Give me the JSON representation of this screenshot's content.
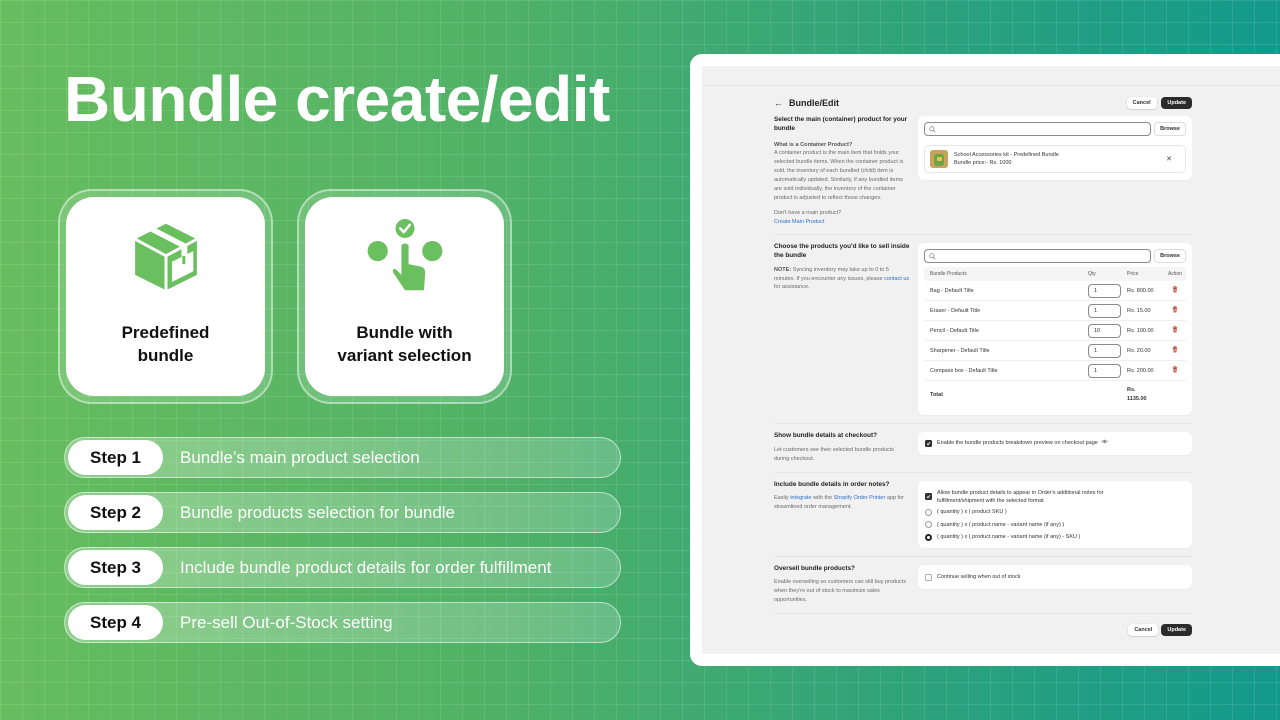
{
  "hero": {
    "title": "Bundle create/edit"
  },
  "feature_cards": [
    {
      "icon": "package-box-icon",
      "label_line1": "Predefined",
      "label_line2": "bundle"
    },
    {
      "icon": "variant-selection-hand-icon",
      "label_line1": "Bundle with",
      "label_line2": "variant selection"
    }
  ],
  "steps": [
    {
      "badge": "Step 1",
      "text": "Bundle’s main product selection"
    },
    {
      "badge": "Step 2",
      "text": "Bundle products selection for bundle"
    },
    {
      "badge": "Step 3",
      "text": "Include bundle product details for order fulfillment"
    },
    {
      "badge": "Step 4",
      "text": "Pre-sell Out-of-Stock setting"
    }
  ],
  "app": {
    "page_title": "Bundle/Edit",
    "cancel_label": "Cancel",
    "update_label": "Update",
    "browse_label": "Browse",
    "search_placeholder": "",
    "section_main": {
      "title": "Select the main (container) product for your bundle",
      "subtitle": "What is a Container Product?",
      "body": "A container product is the main item that holds your selected bundle items. When the container product is sold, the inventory of each bundled (child) item is automatically updated. Similarly, if any bundled items are sold individually, the inventory of the container product is adjusted to reflect those changes.",
      "no_product_text": "Don't have a main product?",
      "create_link": "Create Main Product",
      "selected_product": {
        "name": "School Accessories kit - Predefined Bundle",
        "price": "Bundle price:- Rs. 1000"
      }
    },
    "section_products": {
      "title": "Choose the products you'd like to sell inside the bundle",
      "note_label": "NOTE:",
      "note_body": " Syncing inventory may take up to 0 to 5 minutes. If you encounter any issues, please ",
      "contact_link": "contact us",
      "note_tail": " for assistance.",
      "columns": {
        "name": "Bundle Products",
        "qty": "Qty",
        "price": "Price",
        "action": "Action"
      },
      "rows": [
        {
          "name": "Bag - Default Title",
          "qty": "1",
          "price": "Rs. 800.00"
        },
        {
          "name": "Eraser - Default Title",
          "qty": "1",
          "price": "Rs. 15.00"
        },
        {
          "name": "Pencil - Default Title",
          "qty": "10",
          "price": "Rs. 100.00"
        },
        {
          "name": "Sharpener - Default Title",
          "qty": "1",
          "price": "Rs. 20.00"
        },
        {
          "name": "Compass box - Default Title",
          "qty": "1",
          "price": "Rs. 200.00"
        }
      ],
      "total_label": "Total",
      "total_currency": "Rs.",
      "total_value": "1135.00"
    },
    "section_checkout": {
      "title": "Show bundle details at checkout?",
      "body": "Let customers see their selected bundle products during checkout.",
      "checkbox_label": "Enable the bundle products breakdown preview on checkout page",
      "checked": true
    },
    "section_order_notes": {
      "title": "Include bundle details in order notes?",
      "body_pre": "Easily ",
      "integrate_link": "integrate",
      "body_mid": " with the ",
      "printer_link": "Shopify Order Printer",
      "body_post": " app for streamlined order management.",
      "checkbox_label": "Allow bundle product details to appear in Order's additional notes for fulfillment/shipment with the selected format",
      "checked": true,
      "formats": [
        {
          "label": "( quantity ) x ( product SKU )",
          "selected": false
        },
        {
          "label": "( quantity ) x ( product name - variant name (if any) )",
          "selected": false
        },
        {
          "label": "( quantity ) x ( product name - variant name (if any) - SKU )",
          "selected": true
        }
      ]
    },
    "section_oversell": {
      "title": "Oversell bundle products?",
      "body": "Enable overselling so customers can still buy products when they're out of stock to maximize sales opportunities.",
      "checkbox_label": "Continue selling when out of stock",
      "checked": false
    }
  },
  "colors": {
    "icon_green": "#6abf5e",
    "danger_red": "#c0392b",
    "link_blue": "#2c6ecb",
    "dark_button": "#2b2b2b"
  }
}
